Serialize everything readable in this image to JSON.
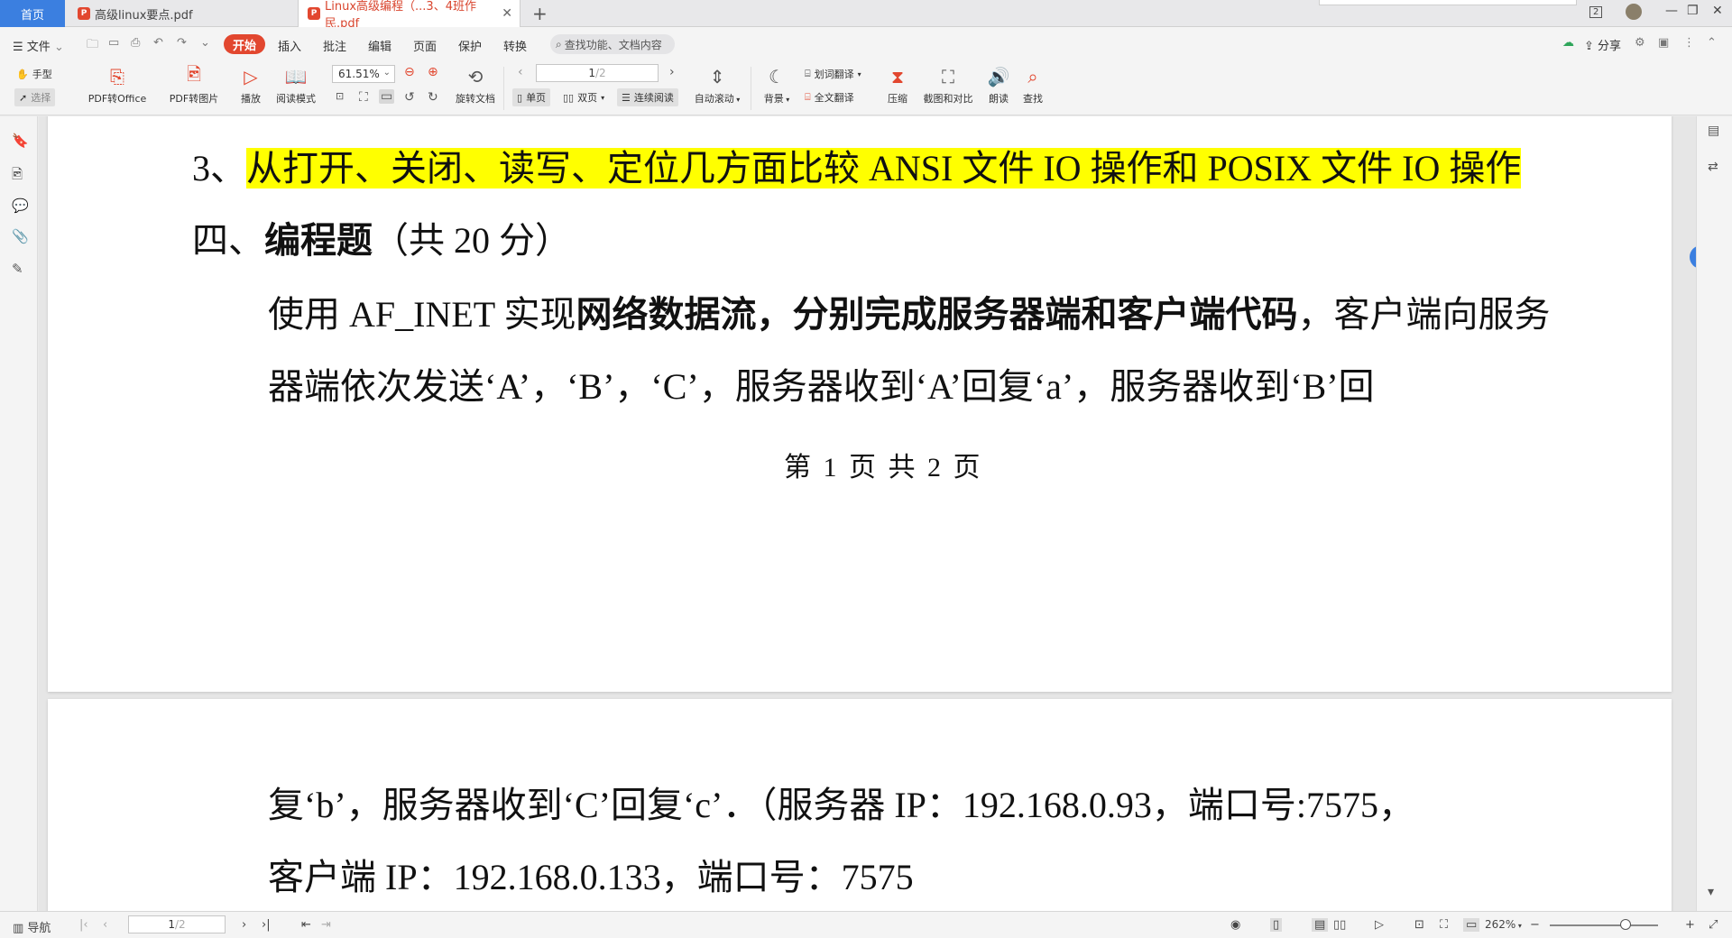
{
  "tabs": {
    "home": "首页",
    "doc1": "高级linux要点.pdf",
    "doc2": "Linux高级编程（...3、4班作民.pdf",
    "pdf_badge": "P"
  },
  "window_badge": "2",
  "menu": {
    "file": "文件",
    "items": [
      "开始",
      "插入",
      "批注",
      "编辑",
      "页面",
      "保护",
      "转换"
    ],
    "search_placeholder": "查找功能、文档内容",
    "share": "分享"
  },
  "ribbon": {
    "hand": "手型",
    "select": "选择",
    "pdf_to_office": "PDF转Office",
    "pdf_to_image": "PDF转图片",
    "play": "播放",
    "read_mode": "阅读模式",
    "zoom": "61.51%",
    "rotate": "旋转文档",
    "page_current": "1",
    "page_total": "/2",
    "single": "单页",
    "double": "双页",
    "continuous": "连续阅读",
    "auto_scroll": "自动滚动",
    "background": "背景",
    "word_translate": "划词翻译",
    "full_translate": "全文翻译",
    "compress": "压缩",
    "screenshot_compare": "截图和对比",
    "read_aloud": "朗读",
    "find": "查找"
  },
  "document": {
    "q3_num": "3、",
    "q3_text": "从打开、关闭、读写、定位几方面比较 ANSI 文件 IO 操作和 POSIX 文件 IO 操作",
    "section4_prefix": "四、",
    "section4_title": "编程题",
    "section4_score": "（共 20 分）",
    "p1_a": "使用 AF_INET 实现",
    "p1_b": "网络数据流，分别完成服务器端和客户端代码",
    "p1_c": "，客户端向服务",
    "p2": "器端依次发送‘A’，‘B’，‘C’，服务器收到‘A’回复‘a’，服务器收到‘B’回",
    "footer": "第 1 页 共 2 页",
    "p3": "复‘b’，服务器收到‘C’回复‘c’．（服务器 IP：192.168.0.93，端口号:7575，",
    "p4": "客户端 IP：192.168.0.133，端口号：7575"
  },
  "status": {
    "nav": "导航",
    "page_current": "1",
    "page_total": "/2",
    "zoom": "262%"
  },
  "colors": {
    "accent": "#e2472f",
    "blue": "#3b7fe0",
    "highlight": "#ffff00"
  }
}
